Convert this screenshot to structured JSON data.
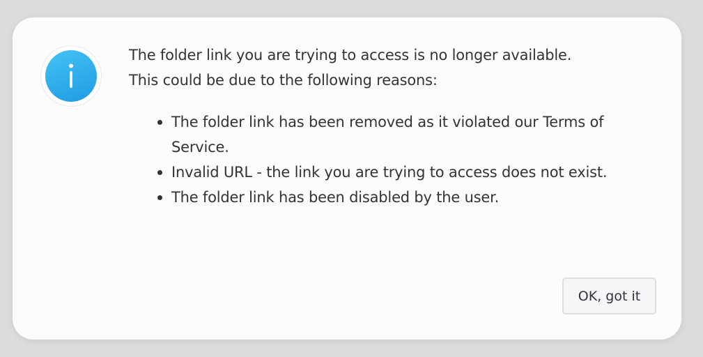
{
  "dialog": {
    "icon": "info-icon",
    "message": "The folder link you are trying to access is no longer available. This could be due to the following reasons:",
    "reasons": [
      {
        "text": "The folder link has been removed as it violated our Terms of Service."
      },
      {
        "text": "Invalid URL - the link you are trying to access does not exist."
      },
      {
        "text": "The folder link has been disabled by the user."
      }
    ],
    "ok_button_label": "OK, got it"
  },
  "colors": {
    "background": "#dcdbdd",
    "dialog": "#fdfcfd",
    "icon_accent": "#2aa8ea",
    "text": "#333236"
  }
}
